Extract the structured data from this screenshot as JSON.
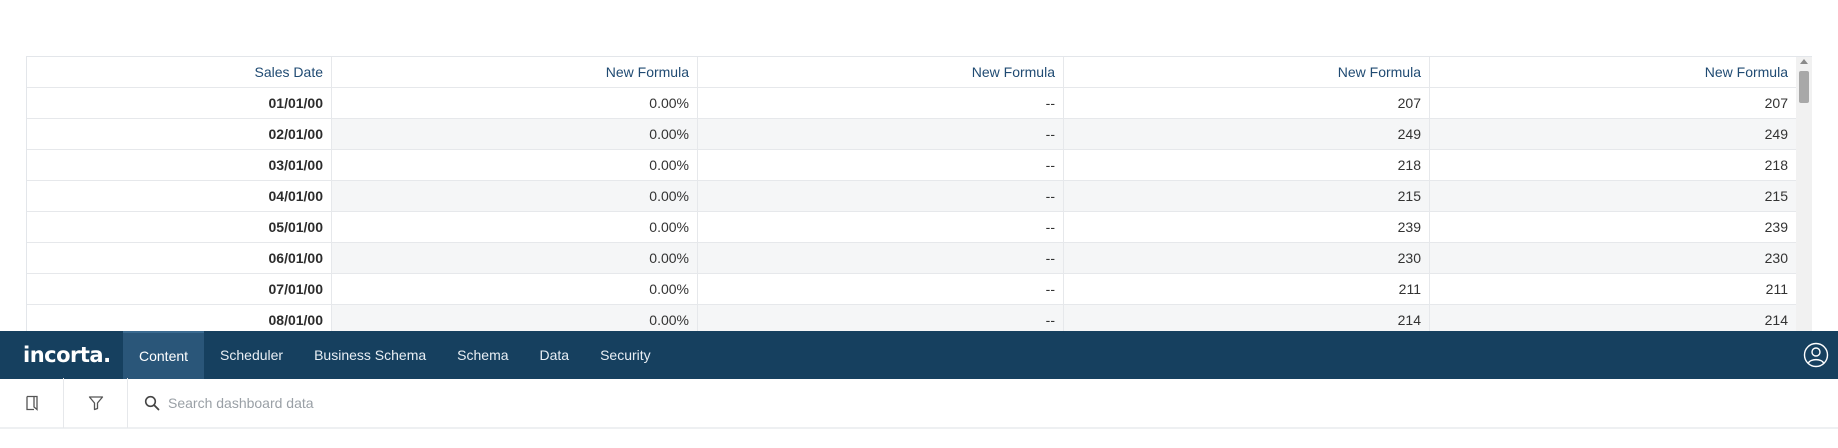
{
  "table": {
    "headers": [
      "Sales Date",
      "New Formula",
      "New Formula",
      "New Formula",
      "New Formula"
    ],
    "rows": [
      [
        "01/01/00",
        "0.00%",
        "--",
        "207",
        "207"
      ],
      [
        "02/01/00",
        "0.00%",
        "--",
        "249",
        "249"
      ],
      [
        "03/01/00",
        "0.00%",
        "--",
        "218",
        "218"
      ],
      [
        "04/01/00",
        "0.00%",
        "--",
        "215",
        "215"
      ],
      [
        "05/01/00",
        "0.00%",
        "--",
        "239",
        "239"
      ],
      [
        "06/01/00",
        "0.00%",
        "--",
        "230",
        "230"
      ],
      [
        "07/01/00",
        "0.00%",
        "--",
        "211",
        "211"
      ],
      [
        "08/01/00",
        "0.00%",
        "--",
        "214",
        "214"
      ]
    ]
  },
  "nav": {
    "logo": "incorta.",
    "items": [
      "Content",
      "Scheduler",
      "Business Schema",
      "Schema",
      "Data",
      "Security"
    ],
    "active": "Content"
  },
  "toolbar": {
    "bookmark_icon": "bookmark-icon",
    "filter_icon": "filter-icon",
    "search_placeholder": "Search dashboard data"
  },
  "colors": {
    "nav_bg": "#16405f",
    "nav_active": "#2a5679",
    "header_text": "#1f4a72"
  }
}
